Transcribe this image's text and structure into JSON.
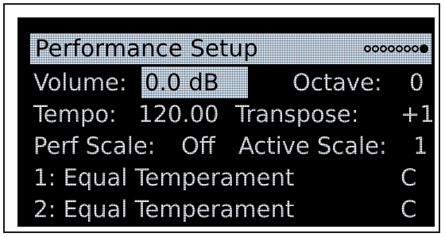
{
  "screen": {
    "title": "Performance Setup",
    "page_count": 8,
    "active_page": 8
  },
  "rows": {
    "volume_label": "Volume:",
    "volume_value": "0.0 dB",
    "octave_label": "Octave:",
    "octave_value": "0",
    "tempo_label": "Tempo:",
    "tempo_value": "120.00",
    "transpose_label": "Transpose:",
    "transpose_value": "+1",
    "perf_scale_label": "Perf Scale:",
    "perf_scale_value": "Off",
    "active_scale_label": "Active Scale:",
    "active_scale_value": "1",
    "scale1_name": "1: Equal Temperament",
    "scale1_key": "C",
    "scale2_name": "2: Equal Temperament",
    "scale2_key": "C"
  },
  "colors": {
    "display_bg": "#000000",
    "display_text": "#e8ecf1",
    "highlight_bg": "#cfe0ee"
  }
}
